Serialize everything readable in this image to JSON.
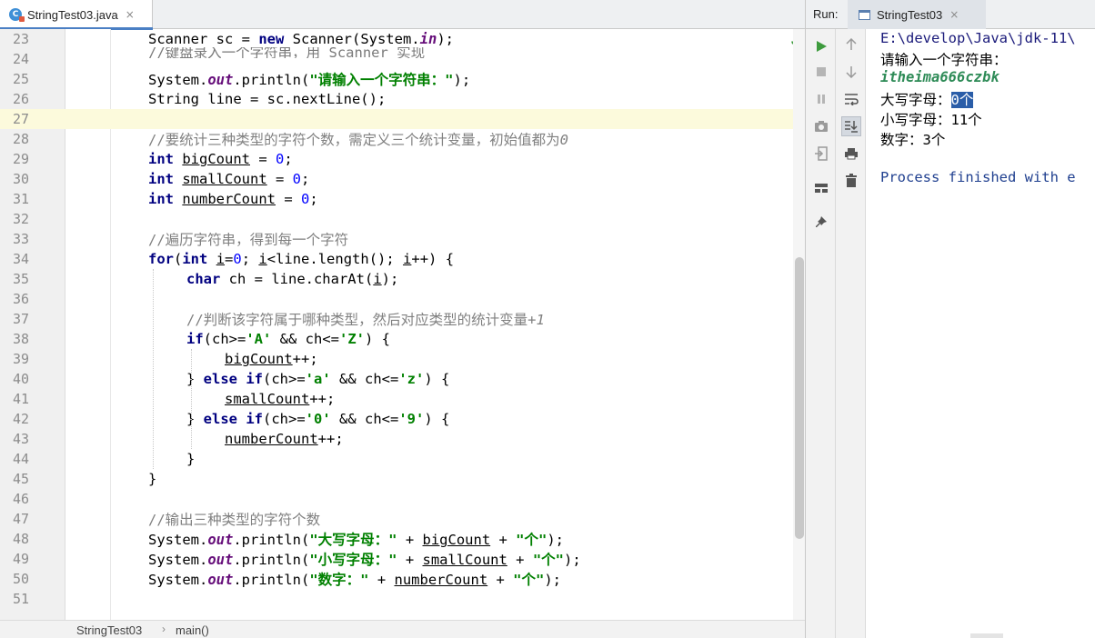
{
  "editor": {
    "tab": {
      "label": "StringTest03.java",
      "close": "×",
      "icon": "java-class-icon"
    },
    "top_partial_comment": "//键盘录入一个字符串，用 Scanner 实现",
    "lines": [
      {
        "n": "23"
      },
      {
        "n": "24"
      },
      {
        "n": "25"
      },
      {
        "n": "26"
      },
      {
        "n": "27"
      },
      {
        "n": "28"
      },
      {
        "n": "29"
      },
      {
        "n": "30"
      },
      {
        "n": "31"
      },
      {
        "n": "32"
      },
      {
        "n": "33"
      },
      {
        "n": "34"
      },
      {
        "n": "35"
      },
      {
        "n": "36"
      },
      {
        "n": "37"
      },
      {
        "n": "38"
      },
      {
        "n": "39"
      },
      {
        "n": "40"
      },
      {
        "n": "41"
      },
      {
        "n": "42"
      },
      {
        "n": "43"
      },
      {
        "n": "44"
      },
      {
        "n": "45"
      },
      {
        "n": "46"
      },
      {
        "n": "47"
      },
      {
        "n": "48"
      },
      {
        "n": "49"
      },
      {
        "n": "50"
      },
      {
        "n": "51"
      }
    ],
    "current_line": "27",
    "code": {
      "l23": [
        "Scanner sc = ",
        "new",
        " Scanner(System.",
        "in",
        ");"
      ],
      "l25": [
        "System.",
        "out",
        ".println(",
        "\"请输入一个字符串：\"",
        ");"
      ],
      "l26": "String line = sc.nextLine();",
      "l28": [
        "//要统计三种类型的字符个数，需定义三个统计变量，初始值都为",
        "0"
      ],
      "l29": [
        "int",
        " ",
        "bigCount",
        " = ",
        "0",
        ";"
      ],
      "l30": [
        "int",
        " ",
        "smallCount",
        " = ",
        "0",
        ";"
      ],
      "l31": [
        "int",
        " ",
        "numberCount",
        " = ",
        "0",
        ";"
      ],
      "l33": "//遍历字符串，得到每一个字符",
      "l34": [
        "for",
        "(",
        "int",
        " ",
        "i",
        "=",
        "0",
        "; ",
        "i",
        "<line.length(); ",
        "i",
        "++) {"
      ],
      "l35": [
        "char",
        " ch = line.charAt(",
        "i",
        ");"
      ],
      "l37": [
        "//判断该字符属于哪种类型，然后对应类型的统计变量",
        "+1"
      ],
      "l38": [
        "if",
        "(ch>=",
        "'A'",
        " && ch<=",
        "'Z'",
        ") {"
      ],
      "l39": [
        "bigCount",
        "++;"
      ],
      "l40": [
        "} ",
        "else if",
        "(ch>=",
        "'a'",
        " && ch<=",
        "'z'",
        ") {"
      ],
      "l41": [
        "smallCount",
        "++;"
      ],
      "l42": [
        "} ",
        "else if",
        "(ch>=",
        "'0'",
        " && ch<=",
        "'9'",
        ") {"
      ],
      "l43": [
        "numberCount",
        "++;"
      ],
      "l44": "}",
      "l45": "}",
      "l47": "//输出三种类型的字符个数",
      "l48": [
        "System.",
        "out",
        ".println(",
        "\"大写字母：\"",
        " + ",
        "bigCount",
        " + ",
        "\"个\"",
        ");"
      ],
      "l49": [
        "System.",
        "out",
        ".println(",
        "\"小写字母：\"",
        " + ",
        "smallCount",
        " + ",
        "\"个\"",
        ");"
      ],
      "l50": [
        "System.",
        "out",
        ".println(",
        "\"数字：\"",
        " + ",
        "numberCount",
        " + ",
        "\"个\"",
        ");"
      ]
    },
    "breadcrumb": {
      "class": "StringTest03",
      "sep": "›",
      "method": "main()"
    },
    "inspection_status": "✓"
  },
  "run": {
    "label": "Run:",
    "tab": {
      "label": "StringTest03",
      "close": "×",
      "icon": "console-window-icon"
    },
    "left_toolbar": [
      "run-icon",
      "stop-icon",
      "pause-icon",
      "camera-icon",
      "exit-icon",
      "layout-icon",
      "pin-icon"
    ],
    "right_toolbar": [
      "arrow-up-icon",
      "arrow-down-icon",
      "soft-wrap-icon",
      "scroll-to-end-icon",
      "print-icon",
      "trash-icon"
    ],
    "console": {
      "path": "E:\\develop\\Java\\jdk-11\\",
      "prompt": "请输入一个字符串：",
      "input": "itheima666czbk",
      "upper_label": "大写字母：",
      "upper_value": "0个",
      "lower": "小写字母：11个",
      "digits": "数字：3个",
      "process": "Process finished with e"
    }
  },
  "colors": {
    "keyword": "#000080",
    "string": "#008000",
    "number": "#0000ff",
    "comment": "#808080",
    "field": "#660e7a",
    "current_line": "#fcfadc",
    "selection": "#2a5da8",
    "run_green": "#3d9b3d"
  }
}
